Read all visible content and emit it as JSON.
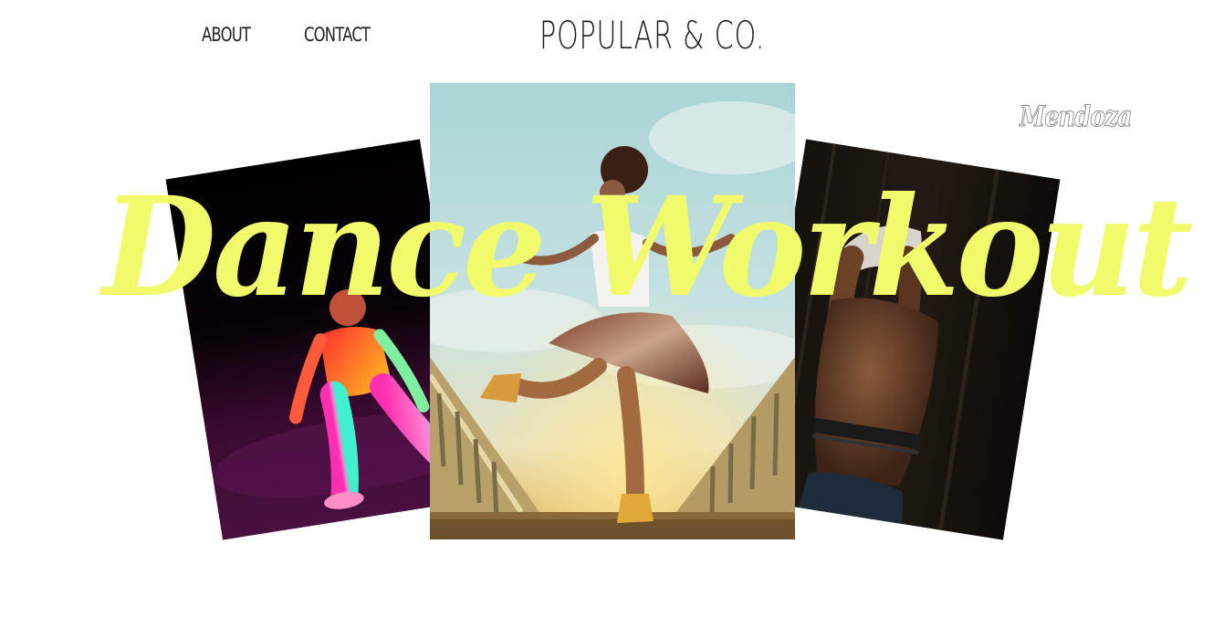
{
  "nav": {
    "about_label": "ABOUT",
    "contact_label": "CONTACT"
  },
  "brand": {
    "name": "POPULAR & CO."
  },
  "hero": {
    "headline": "Dance Workout",
    "signature": "Mendoza"
  },
  "colors": {
    "headline": "#f1fa6b",
    "background": "#ffffff",
    "text": "#1e1e1e"
  },
  "icons": {
    "left_photo": "dancer-neon-lights-photo",
    "center_photo": "dancer-jumping-sky-photo",
    "right_photo": "dancer-back-stretch-photo"
  }
}
